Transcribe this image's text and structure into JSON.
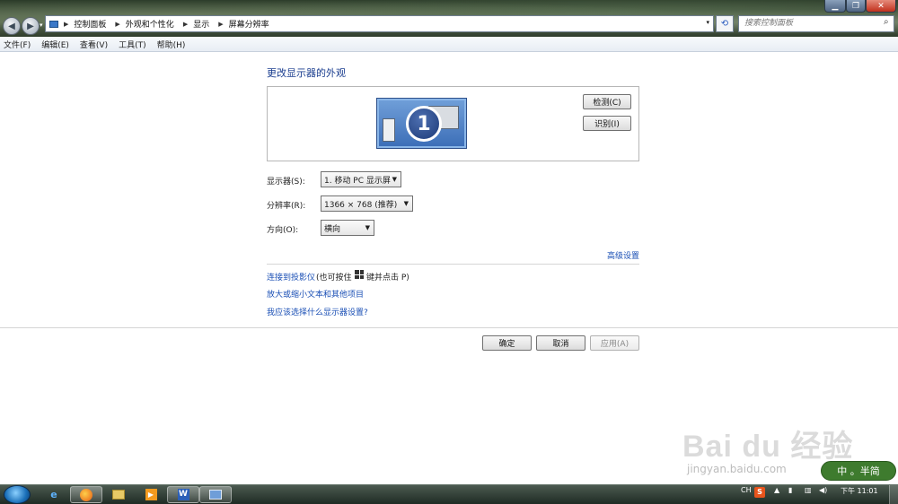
{
  "window": {
    "address": {
      "crumbs": [
        "控制面板",
        "外观和个性化",
        "显示",
        "屏幕分辨率"
      ]
    },
    "search_placeholder": "搜索控制面板"
  },
  "menu": [
    "文件(F)",
    "编辑(E)",
    "查看(V)",
    "工具(T)",
    "帮助(H)"
  ],
  "main": {
    "title": "更改显示器的外观",
    "monitor_number": "1",
    "detect_button": "检测(C)",
    "identify_button": "识别(I)",
    "display_label": "显示器(S):",
    "display_value": "1. 移动 PC 显示屏",
    "resolution_label": "分辨率(R):",
    "resolution_value": "1366 × 768 (推荐)",
    "orientation_label": "方向(O):",
    "orientation_value": "横向",
    "advanced_link": "高级设置",
    "projector_link": "连接到投影仪",
    "projector_hint_pre": "(也可按住",
    "projector_hint_post": "键并点击 P)",
    "text_size_link": "放大或缩小文本和其他项目",
    "help_link": "我应该选择什么显示器设置?",
    "ok_button": "确定",
    "cancel_button": "取消",
    "apply_button": "应用(A)"
  },
  "watermark": {
    "logo": "Bai du 经验",
    "url": "jingyan.baidu.com",
    "ime_label": "中 。半简"
  },
  "taskbar": {
    "lang": "CH",
    "clock": "下午 11:01"
  },
  "colors": {
    "link": "#1a4fb5",
    "heading": "#1a3d8f",
    "monitor_blue": "#3d6fb8"
  }
}
